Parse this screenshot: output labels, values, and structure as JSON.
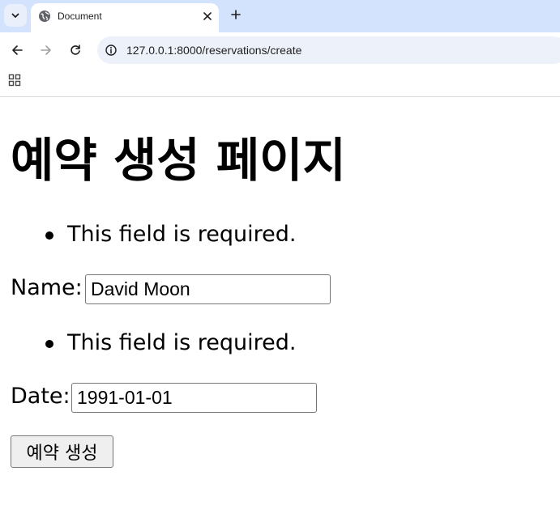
{
  "browser": {
    "tab_title": "Document",
    "address": "127.0.0.1:8000/reservations/create"
  },
  "page": {
    "title": "예약 생성 페이지",
    "name_error": "This field is required.",
    "name_label": "Name:",
    "name_value": "David Moon",
    "date_error": "This field is required.",
    "date_label": "Date:",
    "date_value": "1991-01-01",
    "submit_label": "예약 생성"
  }
}
